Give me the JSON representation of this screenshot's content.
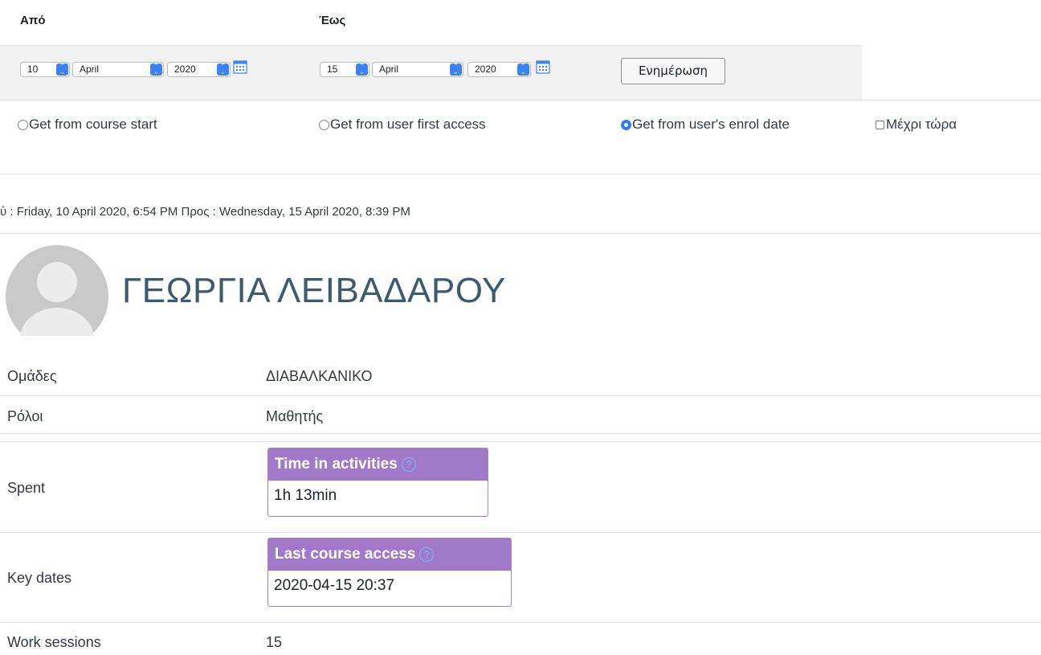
{
  "header": {
    "from_label": "Από",
    "to_label": "Έως"
  },
  "from_date": {
    "day": "10",
    "month": "April",
    "year": "2020"
  },
  "to_date": {
    "day": "15",
    "month": "April",
    "year": "2020"
  },
  "update_button": "Ενημέρωση",
  "radios": [
    {
      "label": "Get from course start",
      "checked": false
    },
    {
      "label": "Get from user first access",
      "checked": false
    },
    {
      "label": "Get from user's enrol date",
      "checked": true
    }
  ],
  "until_now": {
    "label": "Μέχρι τώρα",
    "checked": false
  },
  "period_text": "ὑ : Friday, 10 April 2020, 6:54 PM Προς : Wednesday, 15 April 2020, 8:39 PM",
  "user": {
    "name": "ΓΕΩΡΓΙΑ ΛΕΙΒΑΔΑΡΟΥ"
  },
  "details": {
    "groups_label": "Ομάδες",
    "groups_value": "ΔΙΑΒΑΛΚΑΝΙΚΟ",
    "roles_label": "Ρόλοι",
    "roles_value": "Μαθητής",
    "spent_label": "Spent",
    "time_card_title": "Time in activities",
    "time_card_value": "1h 13min",
    "keydates_label": "Key dates",
    "access_card_title": "Last course access",
    "access_card_value": "2020-04-15 20:37",
    "sessions_label": "Work sessions",
    "sessions_value": "15"
  },
  "colors": {
    "card_header": "#a07ac8",
    "radio_checked": "#2f7df6",
    "name": "#3e5a6d"
  },
  "icons": [
    "calendar-icon",
    "help-icon",
    "avatar-placeholder"
  ]
}
